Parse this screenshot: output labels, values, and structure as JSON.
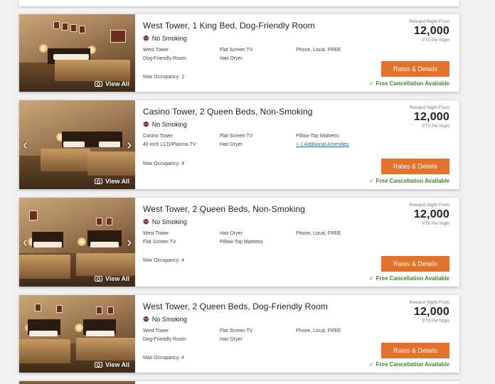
{
  "common": {
    "view_all": "View All",
    "reward_label": "Reward Night From",
    "pts_label": "PTS Per Night",
    "rates_button": "Rates & Details",
    "free_cancel": "Free Cancellation Available",
    "check_glyph": "✓",
    "smoke_glyph": "🚭",
    "prev_glyph": "‹",
    "next_glyph": "›"
  },
  "rooms": [
    {
      "title": "West Tower, 1 King Bed, Dog-Friendly Room",
      "smoking": "No Smoking",
      "amenities": [
        "West Tower",
        "Flat Screen TV",
        "Phone, Local, FREE",
        "Dog-Friendly Room",
        "Hair Dryer",
        ""
      ],
      "occupancy": "Max Occupancy: 2",
      "points": "12,000"
    },
    {
      "title": "Casino Tower, 2 Queen Beds, Non-Smoking",
      "smoking": "No Smoking",
      "amenities": [
        "Casino Tower",
        "Flat Screen TV",
        "Pillow-Top Mattress",
        "40 inch LCD/Plasma TV",
        "Hair Dryer"
      ],
      "amenities_link": "+ 1 Additional Amenities",
      "occupancy": "Max Occupancy: 4",
      "points": "12,000"
    },
    {
      "title": "West Tower, 2 Queen Beds, Non-Smoking",
      "smoking": "No Smoking",
      "amenities": [
        "West Tower",
        "Hair Dryer",
        "Phone, Local, FREE",
        "Flat Screen TV",
        "Pillow-Top Mattress",
        ""
      ],
      "occupancy": "Max Occupancy: 4",
      "points": "12,000"
    },
    {
      "title": "West Tower, 2 Queen Beds, Dog-Friendly Room",
      "smoking": "No Smoking",
      "amenities": [
        "West Tower",
        "Flat Screen TV",
        "Phone, Local, FREE",
        "Dog-Friendly Room",
        "Hair Dryer",
        ""
      ],
      "occupancy": "Max Occupancy: 4",
      "points": "12,000"
    }
  ],
  "colors": {
    "accent_button": "#e3732a",
    "free_cancel_green": "#3b8a2a",
    "link_blue": "#1f6ea8"
  }
}
